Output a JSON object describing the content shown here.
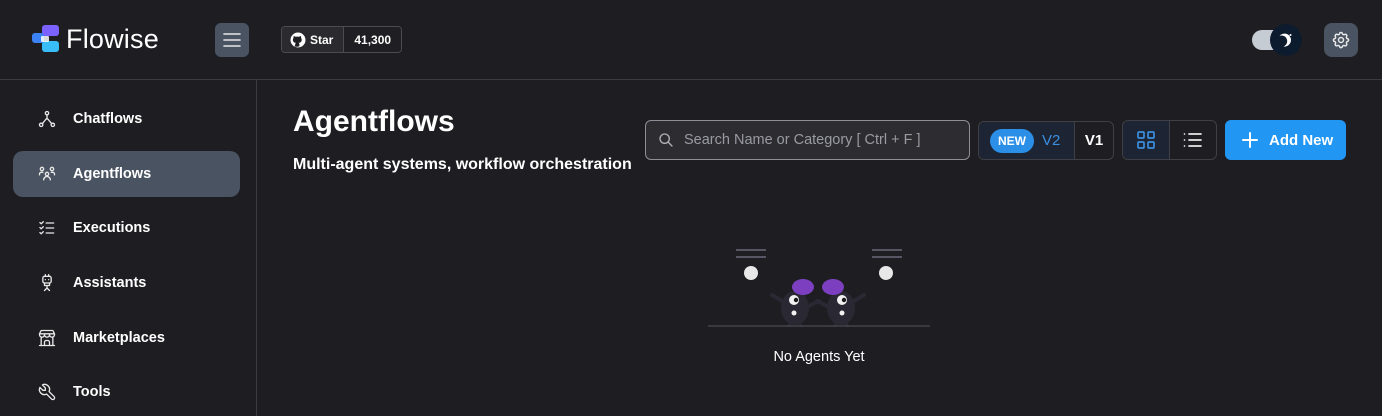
{
  "header": {
    "brand": "Flowise",
    "github": {
      "star_label": "Star",
      "count": "41,300"
    }
  },
  "sidebar": {
    "items": [
      {
        "label": "Chatflows",
        "icon": "hierarchy-icon",
        "active": false
      },
      {
        "label": "Agentflows",
        "icon": "users-group-icon",
        "active": true
      },
      {
        "label": "Executions",
        "icon": "list-check-icon",
        "active": false
      },
      {
        "label": "Assistants",
        "icon": "robot-icon",
        "active": false
      },
      {
        "label": "Marketplaces",
        "icon": "building-store-icon",
        "active": false
      },
      {
        "label": "Tools",
        "icon": "tool-icon",
        "active": false
      }
    ]
  },
  "main": {
    "title": "Agentflows",
    "subtitle": "Multi-agent systems, workflow orchestration",
    "search": {
      "placeholder": "Search Name or Category [ Ctrl + F ]",
      "value": ""
    },
    "version": {
      "new_badge": "NEW",
      "v2": "V2",
      "v1": "V1",
      "selected": "V2"
    },
    "view_mode": "grid",
    "add_button": "Add New",
    "empty_text": "No Agents Yet"
  },
  "colors": {
    "background": "#1e1e22",
    "accent": "#2196f3",
    "active_nav": "#4a5361",
    "illustration_purple": "#7b3fbf"
  }
}
